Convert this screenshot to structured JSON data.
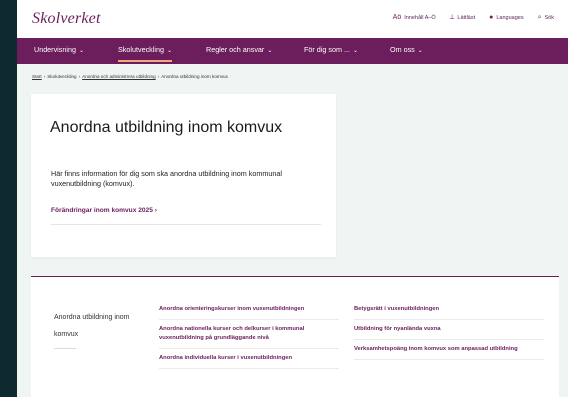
{
  "header": {
    "logo": "Skolverket",
    "utilities": [
      {
        "icon": "a-o-index-icon",
        "glyph": "Aö",
        "label": "Innehåll A–Ö"
      },
      {
        "icon": "easy-read-icon",
        "glyph": "⟂",
        "label": "Lättläst"
      },
      {
        "icon": "globe-icon",
        "glyph": "●",
        "label": "Languages"
      },
      {
        "icon": "search-icon",
        "glyph": "⌕",
        "label": "Sök"
      }
    ]
  },
  "nav": {
    "items": [
      {
        "label": "Undervisning",
        "chevron": "⌄"
      },
      {
        "label": "Skolutveckling",
        "chevron": "⌄"
      },
      {
        "label": "Regler och ansvar",
        "chevron": "⌄"
      },
      {
        "label": "För dig som ...",
        "chevron": "⌄"
      },
      {
        "label": "Om oss",
        "chevron": "⌄"
      }
    ],
    "active_index": 1
  },
  "breadcrumb": {
    "items": [
      "Start",
      "Skolutveckling",
      "Anordna och administrera utbildning",
      "Anordna utbildning inom komvux"
    ],
    "separator": "›"
  },
  "hero": {
    "title": "Anordna utbildning inom komvux",
    "text": "Här finns information för dig som ska anordna utbildning inom kommunal vuxenutbildning (komvux).",
    "link": "Förändringar inom komvux 2025 ›"
  },
  "panel": {
    "side_title": "Anordna utbildning inom komvux",
    "column1": [
      "Anordna orienteringskurser inom vuxenutbildningen",
      "Anordna nationella kurser och delkurser i kommunal vuxenutbildning på grundläggande nivå",
      "Anordna individuella kurser i vuxenutbildningen"
    ],
    "column2": [
      "Betygsrätt i vuxenutbildningen",
      "Utbildning för nyanlända vuxna",
      "Verksamhetspoäng inom komvux som anpassad utbildning"
    ]
  },
  "colors": {
    "brand": "#6b1d5c",
    "nav_accent": "#f3a77c",
    "page_bg": "#eef5f3",
    "outer_bg": "#0f2a2e"
  }
}
